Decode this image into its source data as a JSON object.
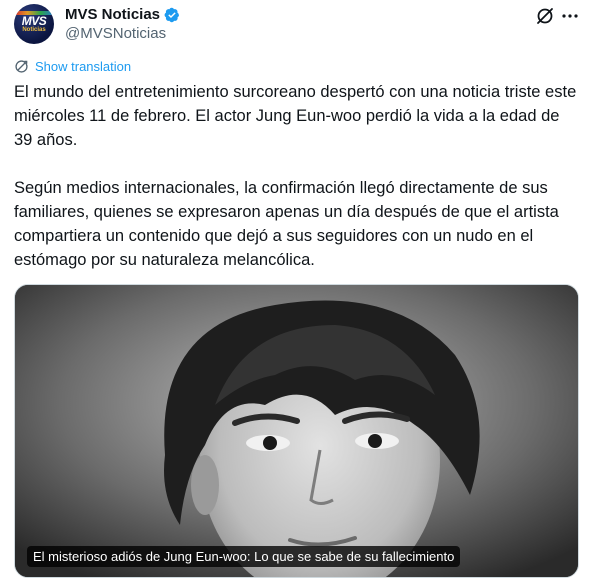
{
  "account": {
    "display_name": "MVS Noticias",
    "handle": "@MVSNoticias",
    "avatar_text": "MVS",
    "avatar_subtext": "Noticias",
    "verified": true
  },
  "translate_label": "Show translation",
  "tweet": {
    "paragraph_1": "El mundo del entretenimiento surcoreano despertó con una noticia triste este miércoles 11 de febrero. El actor Jung Eun-woo perdió la vida a la edad de 39 años.",
    "paragraph_2": "Según medios internacionales, la confirmación llegó directamente de sus familiares, quienes se expresaron apenas un día después de que el artista compartiera un contenido que dejó a sus seguidores con un nudo en el estómago por su naturaleza melancólica."
  },
  "media": {
    "caption": "El misterioso adiós de Jung Eun-woo: Lo que se sabe de su fallecimiento",
    "style": "black-and-white portrait photo"
  },
  "icons": {
    "verified": "verified-badge-icon",
    "grok": "grok-icon",
    "more": "more-options-icon",
    "translate": "translate-globe-icon"
  },
  "colors": {
    "link": "#1d9bf0",
    "secondary_text": "#536471",
    "verified": "#1d9bf0"
  }
}
